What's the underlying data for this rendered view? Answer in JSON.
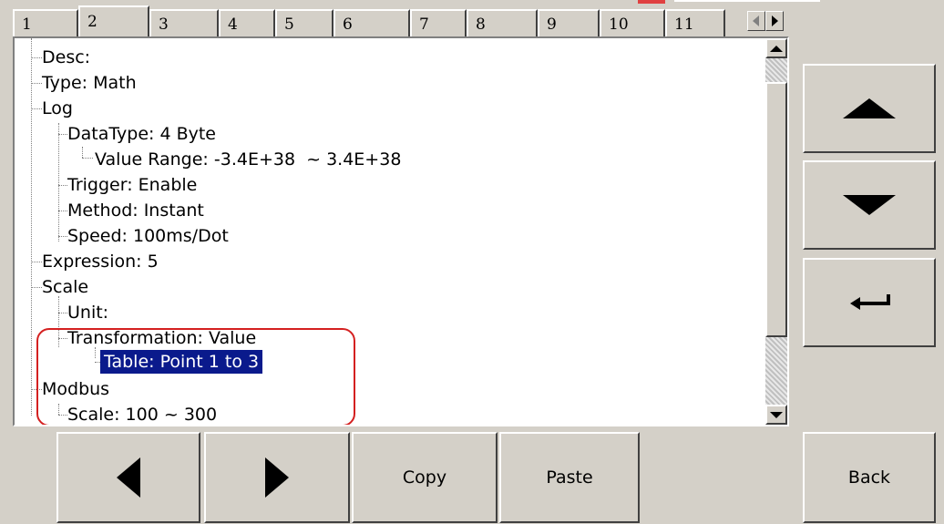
{
  "tabs": [
    "1",
    "2",
    "3",
    "4",
    "5",
    "6",
    "7",
    "8",
    "9",
    "10",
    "11"
  ],
  "active_tab": "2",
  "tree": {
    "nodes": [
      {
        "text": "Desc:"
      },
      {
        "text": "Type: Math"
      },
      {
        "text": "Log"
      },
      {
        "text": "DataType: 4 Byte"
      },
      {
        "text": "Value Range: -3.4E+38  ~ 3.4E+38"
      },
      {
        "text": "Trigger: Enable"
      },
      {
        "text": "Method: Instant"
      },
      {
        "text": "Speed: 100ms/Dot"
      },
      {
        "text": "Expression: 5"
      },
      {
        "text": "Scale"
      },
      {
        "text": "Unit:"
      },
      {
        "text": "Transformation: Value"
      },
      {
        "text": "Table: Point 1 to 3"
      },
      {
        "text": "Modbus"
      },
      {
        "text": "Scale: 100 ~ 300"
      }
    ],
    "selected": "Table: Point 1 to 3"
  },
  "right_buttons": {
    "up": "up-arrow-icon",
    "down": "down-arrow-icon",
    "enter": "enter-icon"
  },
  "bottom_buttons": {
    "prev": "left-arrow-icon",
    "next": "right-arrow-icon",
    "copy_label": "Copy",
    "paste_label": "Paste",
    "back_label": "Back"
  },
  "colors": {
    "face": "#d4d0c8",
    "selection": "#0a1a8c",
    "annotation": "#d42020"
  }
}
